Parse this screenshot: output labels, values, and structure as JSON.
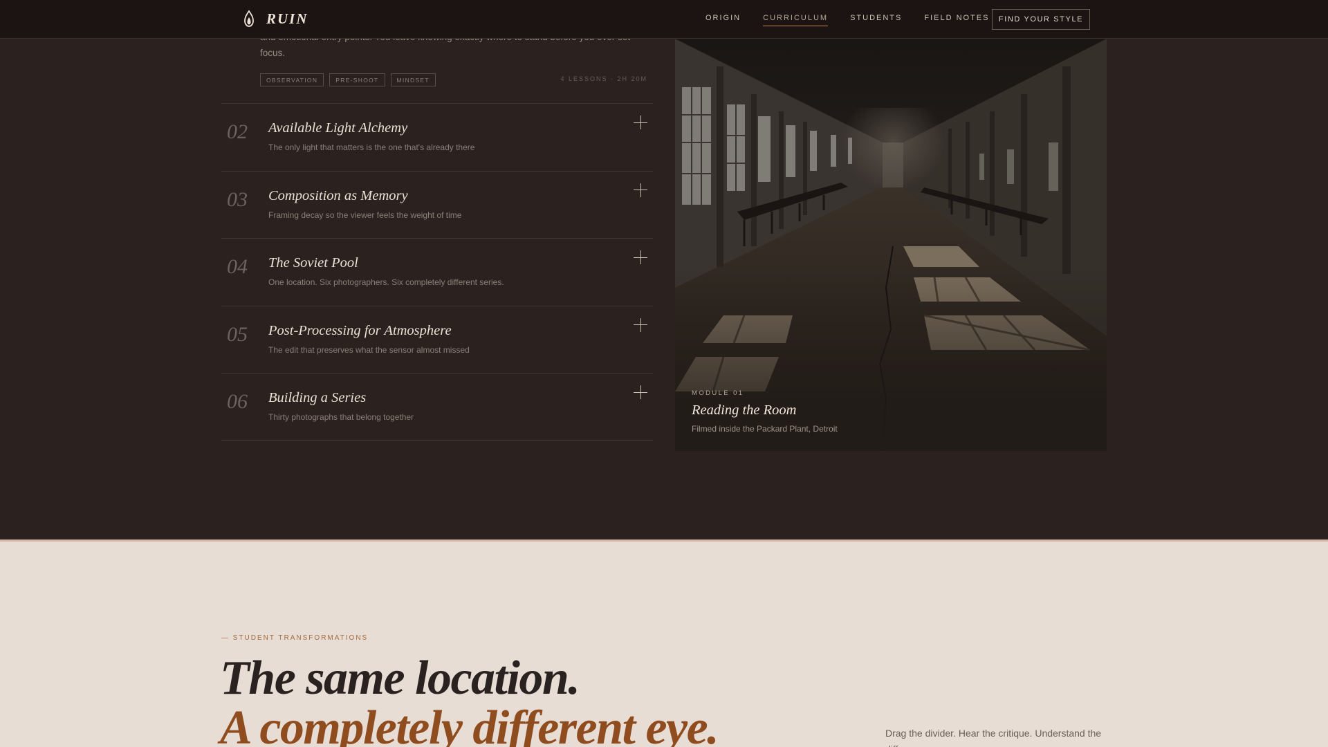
{
  "nav": {
    "brand": "RUIN",
    "links": [
      {
        "label": "ORIGIN",
        "active": false
      },
      {
        "label": "CURRICULUM",
        "active": true
      },
      {
        "label": "STUDENTS",
        "active": false
      },
      {
        "label": "FIELD NOTES",
        "active": false
      }
    ],
    "cta": "FIND YOUR STYLE"
  },
  "module_01": {
    "description_fragment": "and emotional entry points. You leave knowing exactly where to stand before you ever set focus.",
    "tags": [
      "OBSERVATION",
      "PRE-SHOOT",
      "MINDSET"
    ],
    "meta": "4 LESSONS · 2H 20M"
  },
  "modules": [
    {
      "num": "02",
      "title": "Available Light Alchemy",
      "subtitle": "The only light that matters is the one that's already there"
    },
    {
      "num": "03",
      "title": "Composition as Memory",
      "subtitle": "Framing decay so the viewer feels the weight of time"
    },
    {
      "num": "04",
      "title": "The Soviet Pool",
      "subtitle": "One location. Six photographers. Six completely different series."
    },
    {
      "num": "05",
      "title": "Post-Processing for Atmosphere",
      "subtitle": "The edit that preserves what the sensor almost missed"
    },
    {
      "num": "06",
      "title": "Building a Series",
      "subtitle": "Thirty photographs that belong together"
    }
  ],
  "feature": {
    "kicker": "MODULE 01",
    "title": "Reading the Room",
    "subtitle": "Filmed inside the Packard Plant, Detroit"
  },
  "transformations": {
    "kicker": "— STUDENT TRANSFORMATIONS",
    "headline_line1": "The same location.",
    "headline_line2": "A completely different eye.",
    "side_note": "Drag the divider. Hear the critique. Understand the difference."
  },
  "colors": {
    "nav_bg": "#1c1412",
    "dark_bg": "#2b2220",
    "light_bg": "#e7ddd4",
    "accent": "#8f4c1e",
    "nav_active_underline": "#c48a5a"
  },
  "icons": {
    "brand": "flame-lantern-icon",
    "module_toggle": "plus-icon"
  }
}
